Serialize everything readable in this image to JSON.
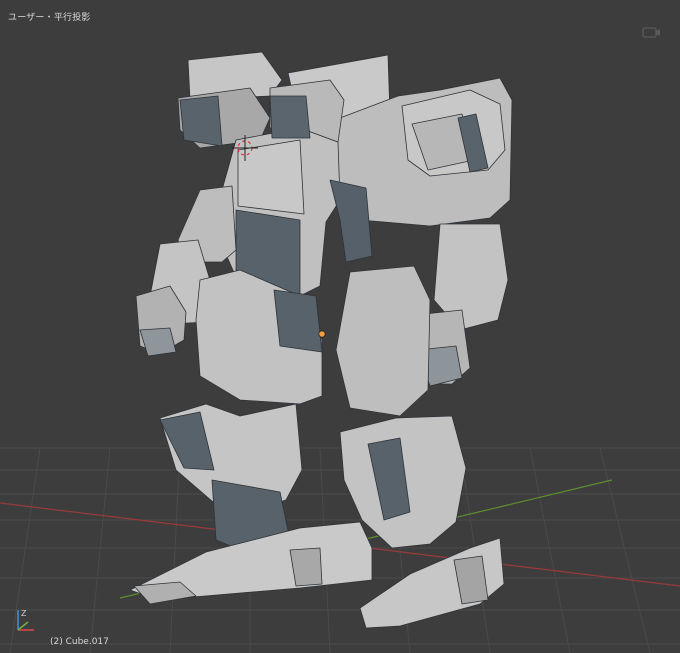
{
  "viewport": {
    "view_label": "ユーザー・平行投影",
    "object_label": "(2) Cube.017"
  },
  "colors": {
    "background": "#3d3d3d",
    "grid": "#4a4a4a",
    "x_axis": "#9a3a3a",
    "y_axis": "#5f8f2f",
    "mesh_light": "#c4c4c4",
    "mesh_mid": "#a9a9a9",
    "mesh_dark": "#566069",
    "origin_dot": "#f0a040"
  },
  "icons": [
    "3d-cursor-icon",
    "axis-gizmo-icon",
    "camera-lock-icon",
    "object-origin-icon"
  ]
}
